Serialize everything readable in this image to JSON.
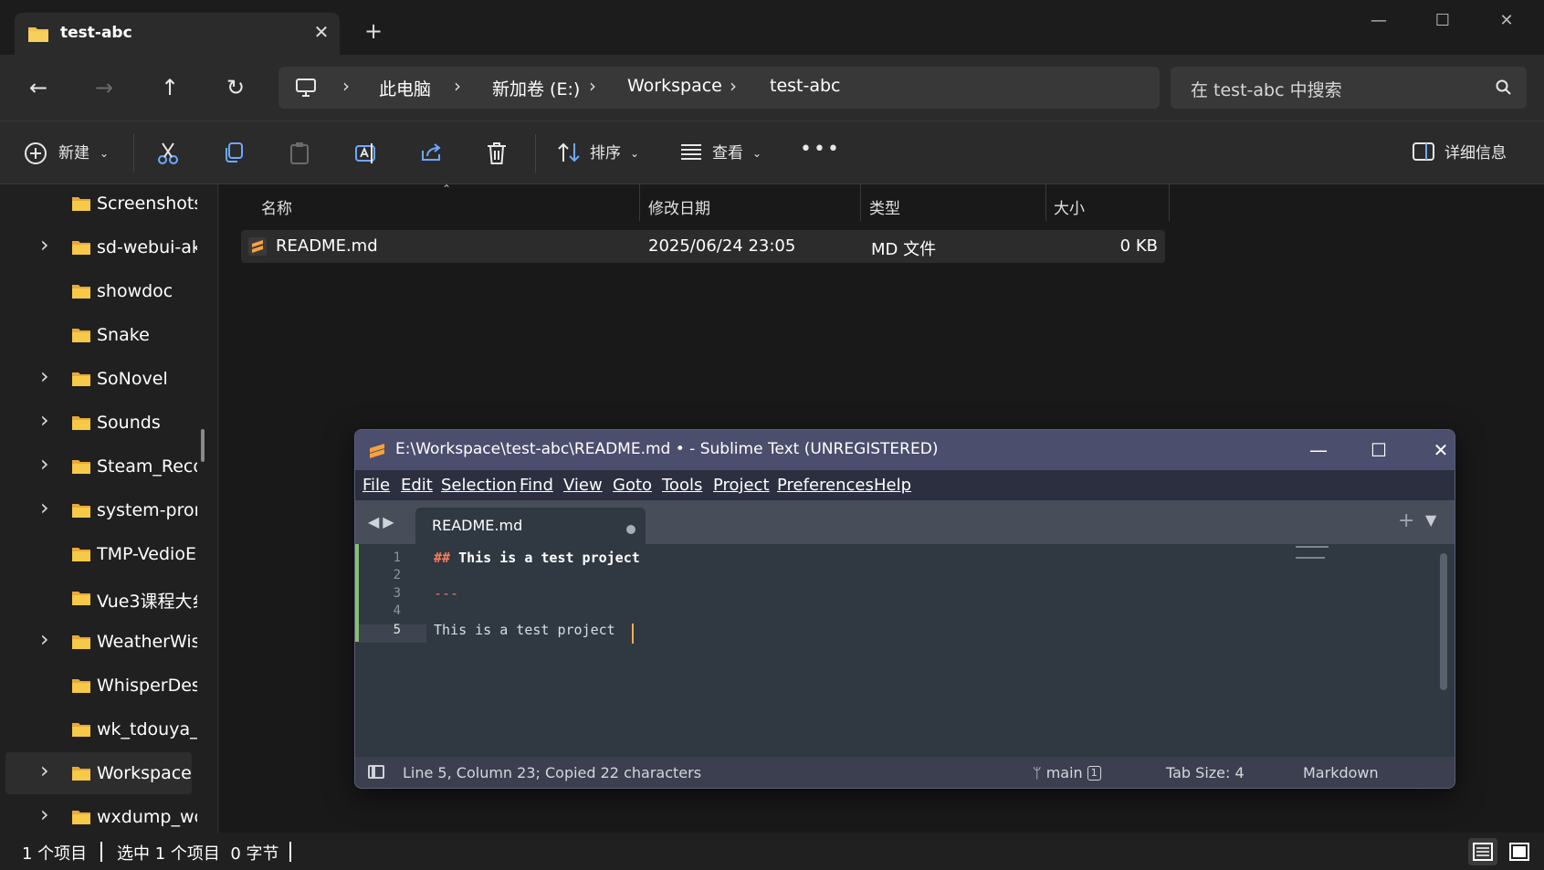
{
  "explorer": {
    "tab_title": "test-abc",
    "address": {
      "crumbs": [
        "此电脑",
        "新加卷 (E:)",
        "Workspace",
        "test-abc"
      ]
    },
    "search_placeholder": "在 test-abc 中搜索",
    "toolbar": {
      "new_label": "新建",
      "sort_label": "排序",
      "view_label": "查看",
      "details_label": "详细信息"
    },
    "sidebar": {
      "items": [
        {
          "label": "Screenshots",
          "has_children": false
        },
        {
          "label": "sd-webui-ak",
          "has_children": true
        },
        {
          "label": "showdoc",
          "has_children": false
        },
        {
          "label": "Snake",
          "has_children": false
        },
        {
          "label": "SoNovel",
          "has_children": true
        },
        {
          "label": "Sounds",
          "has_children": true
        },
        {
          "label": "Steam_Reco",
          "has_children": true
        },
        {
          "label": "system-pror",
          "has_children": true
        },
        {
          "label": "TMP-VedioE",
          "has_children": false
        },
        {
          "label": "Vue3课程大纟",
          "has_children": false
        },
        {
          "label": "WeatherWis",
          "has_children": true
        },
        {
          "label": "WhisperDes",
          "has_children": false
        },
        {
          "label": "wk_tdouya_",
          "has_children": false
        },
        {
          "label": "Workspace",
          "has_children": true,
          "selected": true
        },
        {
          "label": "wxdump_wc",
          "has_children": true
        }
      ]
    },
    "columns": [
      "名称",
      "修改日期",
      "类型",
      "大小"
    ],
    "files": [
      {
        "name": "README.md",
        "modified": "2025/06/24 23:05",
        "type": "MD 文件",
        "size": "0 KB"
      }
    ],
    "status": {
      "item_count": "1 个项目",
      "selection": "选中 1 个项目  0 字节"
    }
  },
  "sublime": {
    "title": "E:\\Workspace\\test-abc\\README.md • - Sublime Text (UNREGISTERED)",
    "menu": [
      "File",
      "Edit",
      "Selection",
      "Find",
      "View",
      "Goto",
      "Tools",
      "Project",
      "Preferences",
      "Help"
    ],
    "tab_label": "README.md",
    "lines": [
      {
        "num": "1",
        "hash": "##",
        "text": " This is a test project"
      },
      {
        "num": "2",
        "text": ""
      },
      {
        "num": "3",
        "text": "---"
      },
      {
        "num": "4",
        "text": ""
      },
      {
        "num": "5",
        "text": "This is a test project"
      }
    ],
    "status": {
      "position": "Line 5, Column 23; Copied 22 characters",
      "branch": "main",
      "branch_count": "1",
      "tab_size": "Tab Size: 4",
      "syntax": "Markdown"
    }
  },
  "colors": {
    "sublime_title_bar": "#4b4e6c",
    "editor_bg": "#303841",
    "markdown_heading": "#f97b58",
    "caret": "#f9ae58",
    "folder": "#f2c14e"
  }
}
